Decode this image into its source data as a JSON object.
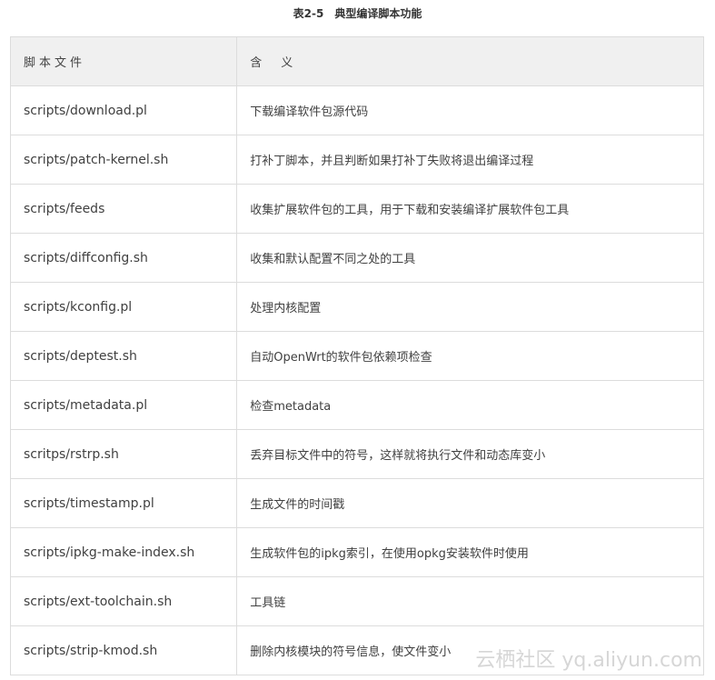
{
  "caption": "表2-5　典型编译脚本功能",
  "table": {
    "headers": [
      "脚本文件",
      "含　义"
    ],
    "rows": [
      {
        "file": "scripts/download.pl",
        "desc": "下载编译软件包源代码"
      },
      {
        "file": "scripts/patch-kernel.sh",
        "desc": "打补丁脚本，并且判断如果打补丁失败将退出编译过程"
      },
      {
        "file": "scripts/feeds",
        "desc": "收集扩展软件包的工具，用于下载和安装编译扩展软件包工具"
      },
      {
        "file": "scripts/diffconfig.sh",
        "desc": "收集和默认配置不同之处的工具"
      },
      {
        "file": "scripts/kconfig.pl",
        "desc": "处理内核配置"
      },
      {
        "file": "scripts/deptest.sh",
        "desc": "自动OpenWrt的软件包依赖项检查"
      },
      {
        "file": "scripts/metadata.pl",
        "desc": "检查metadata"
      },
      {
        "file": "scritps/rstrp.sh",
        "desc": "丢弃目标文件中的符号，这样就将执行文件和动态库变小"
      },
      {
        "file": "scripts/timestamp.pl",
        "desc": "生成文件的时间戳"
      },
      {
        "file": "scripts/ipkg-make-index.sh",
        "desc": "生成软件包的ipkg索引，在使用opkg安装软件时使用"
      },
      {
        "file": "scripts/ext-toolchain.sh",
        "desc": "工具链"
      },
      {
        "file": "scripts/strip-kmod.sh",
        "desc": "删除内核模块的符号信息，使文件变小"
      }
    ]
  },
  "watermark": "云栖社区 yq.aliyun.com"
}
